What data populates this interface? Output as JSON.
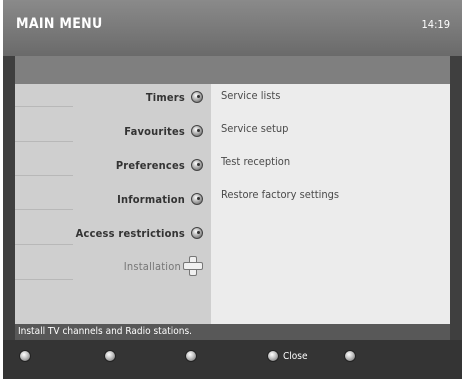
{
  "header": {
    "title": "MAIN MENU",
    "clock": "14:19"
  },
  "menu": {
    "items": [
      {
        "label": "Timers"
      },
      {
        "label": "Favourites"
      },
      {
        "label": "Preferences"
      },
      {
        "label": "Information"
      },
      {
        "label": "Access restrictions"
      },
      {
        "label": "Installation",
        "selected": true
      }
    ],
    "icons": {
      "default": "knob-icon",
      "selected": "dpad-navigation-icon"
    }
  },
  "submenu": {
    "items": [
      {
        "label": "Service lists"
      },
      {
        "label": "Service setup"
      },
      {
        "label": "Test reception"
      },
      {
        "label": "Restore factory settings"
      }
    ]
  },
  "status": {
    "text": "Install TV channels and Radio stations."
  },
  "footer": {
    "buttons": [
      {
        "label": "",
        "icon": "red-key-icon"
      },
      {
        "label": "",
        "icon": "green-key-icon"
      },
      {
        "label": "",
        "icon": "yellow-key-icon"
      },
      {
        "label": "Close",
        "icon": "blue-key-icon"
      },
      {
        "label": "",
        "icon": "option-key-icon"
      }
    ]
  }
}
